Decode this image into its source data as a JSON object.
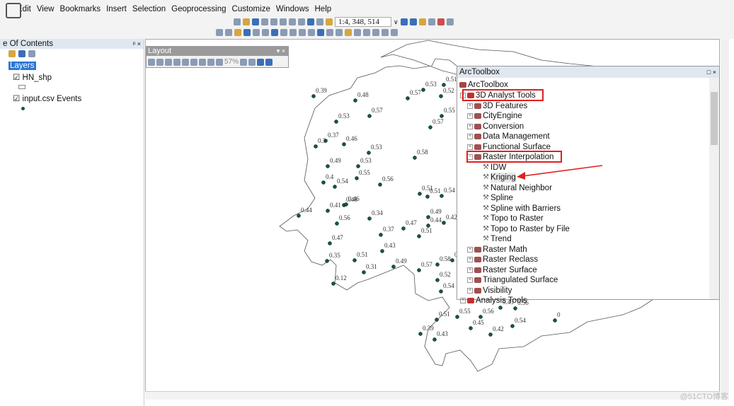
{
  "menu": {
    "items": [
      "Edit",
      "View",
      "Bookmarks",
      "Insert",
      "Selection",
      "Geoprocessing",
      "Customize",
      "Windows",
      "Help"
    ],
    "first_visible": "dit"
  },
  "toolbar": {
    "scale": "1:4, 348, 514",
    "scale_dropdown": "∨"
  },
  "toc": {
    "title": "e Of Contents",
    "pin": "ᵖ ×",
    "root": "Layers",
    "layers": [
      {
        "name": "HN_shp",
        "checked": true
      },
      {
        "name": "input.csv Events",
        "checked": true
      }
    ]
  },
  "layout_window": {
    "title": "Layout",
    "zoom": "57%",
    "controls": "▾ ×"
  },
  "toolbox": {
    "title": "ArcToolbox",
    "controls": "□ ×",
    "root": "ArcToolbox",
    "items": [
      {
        "label": "3D Analyst Tools",
        "expanded": true,
        "highlighted": true
      },
      {
        "label": "3D Features"
      },
      {
        "label": "CityEngine"
      },
      {
        "label": "Conversion"
      },
      {
        "label": "Data Management"
      },
      {
        "label": "Functional Surface"
      },
      {
        "label": "Raster Interpolation",
        "expanded": true,
        "highlighted": true
      },
      {
        "label": "IDW"
      },
      {
        "label": "Kriging",
        "selected": true
      },
      {
        "label": "Natural Neighbor"
      },
      {
        "label": "Spline"
      },
      {
        "label": "Spline with Barriers"
      },
      {
        "label": "Topo to Raster"
      },
      {
        "label": "Topo to Raster by File"
      },
      {
        "label": "Trend"
      },
      {
        "label": "Raster Math"
      },
      {
        "label": "Raster Reclass"
      },
      {
        "label": "Raster Surface"
      },
      {
        "label": "Triangulated Surface"
      },
      {
        "label": "Visibility"
      },
      {
        "label": "Analysis Tools"
      }
    ]
  },
  "map": {
    "point_labels": [
      "0.39",
      "0.48",
      "0.57",
      "0.53",
      "0.51",
      "0.52",
      "0.57",
      "0.53",
      "0.55",
      "0.57",
      "0.37",
      "0.3",
      "0.46",
      "0.53",
      "0.58",
      "0.49",
      "0.53",
      "0.55",
      "0.4",
      "0.54",
      "0.56",
      "0.51",
      "0.51",
      "0.54",
      "0.48",
      "0.46",
      "0.41",
      "0.44",
      "0.56",
      "0.34",
      "0.49",
      "0.44",
      "0.42",
      "0.47",
      "0.37",
      "0.51",
      "0.47",
      "0.43",
      "0.35",
      "0.51",
      "0.31",
      "0.49",
      "0.57",
      "0.58",
      "0",
      "0.52",
      "0.54",
      "0.12",
      "0.43",
      "0.56",
      "0.51",
      "0.55",
      "0.56",
      "0.45",
      "0.42",
      "0.54",
      "0",
      "0.39",
      "0.43"
    ],
    "point_color": "#0f5a4a",
    "annotation_color": "#e02020"
  },
  "watermark": "@51CTO博客"
}
